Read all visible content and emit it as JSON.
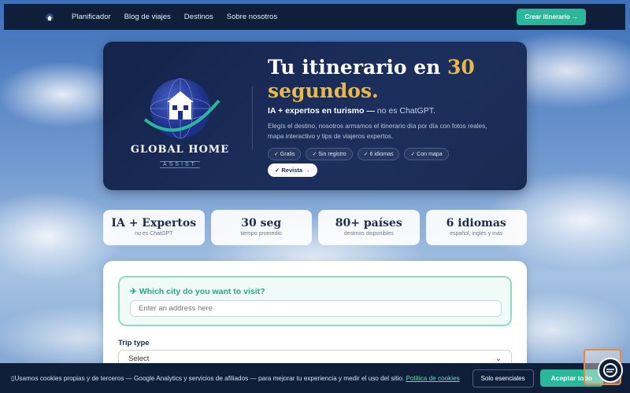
{
  "nav": {
    "links": [
      "Planificador",
      "Blog de viajes",
      "Destinos",
      "Sobre nosotros"
    ],
    "cta": "Crear itinerario →"
  },
  "hero": {
    "brand_name": "GLOBAL HOME",
    "brand_sub": "ASSIST",
    "title_main": "Tu itinerario en ",
    "title_highlight": "30 segundos.",
    "tag_bold": "IA + expertos en turismo —",
    "tag_rest": " no es ChatGPT.",
    "description": "Elegís el destino, nosotros armamos el itinerario día por día con fotos reales, mapa interactivo y tips de viajeros expertos.",
    "pills": [
      "✓ Gratis",
      "✓ Sin registro",
      "✓ 6 idiomas",
      "✓ Con mapa"
    ],
    "review_button": "✓ Revista →"
  },
  "stats": [
    {
      "value": "IA + Expertos",
      "label": "no es ChatGPT"
    },
    {
      "value": "30 seg",
      "label": "tiempo promedio"
    },
    {
      "value": "80+ países",
      "label": "destinos disponibles"
    },
    {
      "value": "6 idiomas",
      "label": "español, inglés y más"
    }
  ],
  "form": {
    "city_question": "✈ Which city do you want to visit?",
    "city_placeholder": "Enter an address here",
    "trip_type_label": "Trip type",
    "trip_type_value": "Select"
  },
  "cookie": {
    "text": "Usamos cookies propias y de terceros — Google Analytics y servicios de afiliados — para mejorar tu experiencia y medir el uso del sitio. ",
    "policy_link": "Política de cookies",
    "essential_button": "Solo esenciales",
    "accept_button": "Aceptar todo"
  },
  "colors": {
    "navy": "#0f1f3a",
    "accent": "#2bb89a",
    "gold": "#e8b94a"
  }
}
